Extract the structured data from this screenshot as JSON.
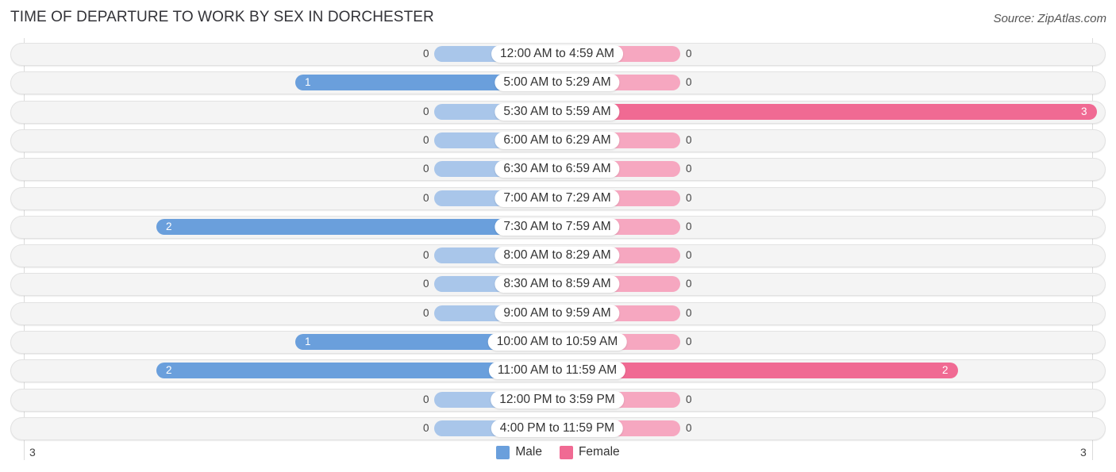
{
  "header": {
    "title": "TIME OF DEPARTURE TO WORK BY SEX IN DORCHESTER",
    "source": "Source: ZipAtlas.com"
  },
  "colors": {
    "male": "#6a9fdc",
    "male_zero": "#a9c6ea",
    "female": "#f06a93",
    "female_zero": "#f6a7c0"
  },
  "chart_data": {
    "type": "bar",
    "orientation": "horizontal-diverging",
    "title": "TIME OF DEPARTURE TO WORK BY SEX IN DORCHESTER",
    "categories": [
      "12:00 AM to 4:59 AM",
      "5:00 AM to 5:29 AM",
      "5:30 AM to 5:59 AM",
      "6:00 AM to 6:29 AM",
      "6:30 AM to 6:59 AM",
      "7:00 AM to 7:29 AM",
      "7:30 AM to 7:59 AM",
      "8:00 AM to 8:29 AM",
      "8:30 AM to 8:59 AM",
      "9:00 AM to 9:59 AM",
      "10:00 AM to 10:59 AM",
      "11:00 AM to 11:59 AM",
      "12:00 PM to 3:59 PM",
      "4:00 PM to 11:59 PM"
    ],
    "series": [
      {
        "name": "Male",
        "values": [
          0,
          1,
          0,
          0,
          0,
          0,
          2,
          0,
          0,
          0,
          1,
          2,
          0,
          0
        ]
      },
      {
        "name": "Female",
        "values": [
          0,
          0,
          3,
          0,
          0,
          0,
          0,
          0,
          0,
          0,
          0,
          2,
          0,
          0
        ]
      }
    ],
    "xlim": [
      -3,
      3
    ],
    "axis_tick_labels": {
      "left": "3",
      "right": "3"
    },
    "legend": {
      "position": "bottom-center",
      "entries": [
        "Male",
        "Female"
      ]
    },
    "grid": false
  }
}
